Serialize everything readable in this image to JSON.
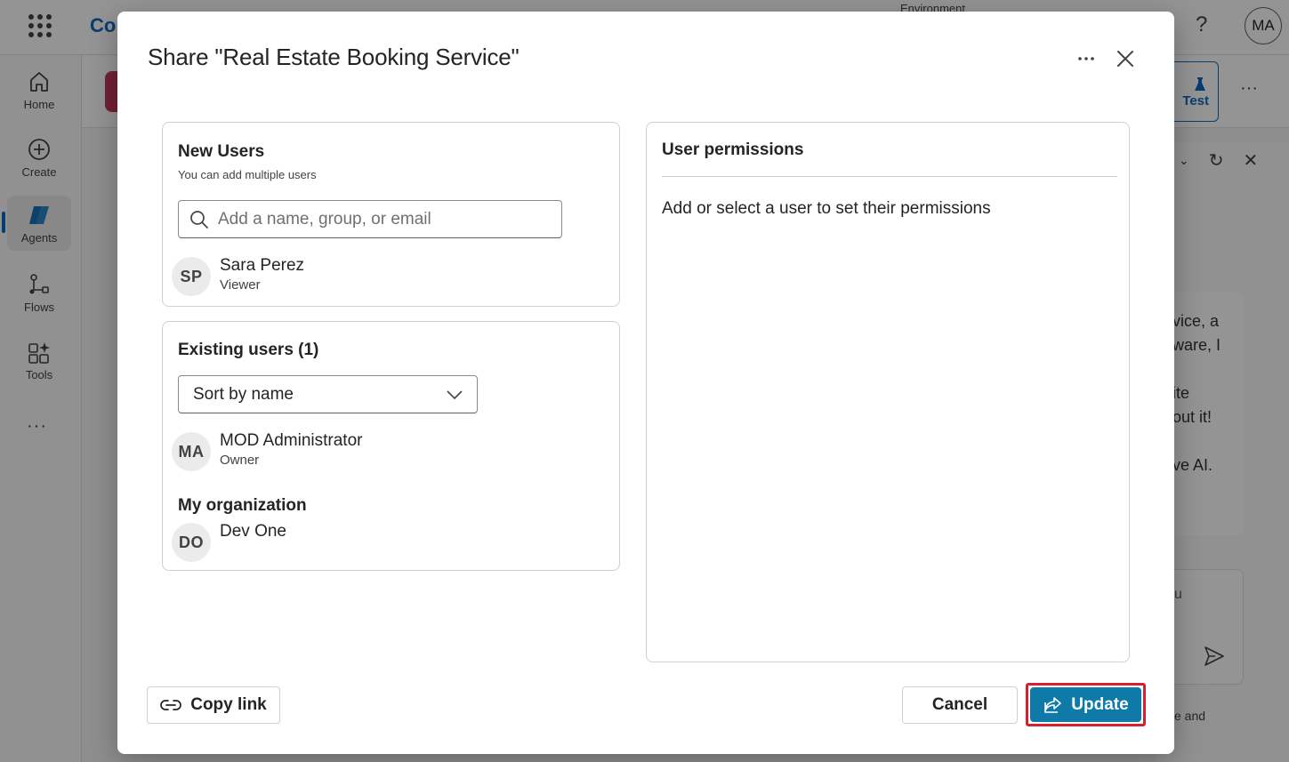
{
  "app": {
    "name_fragment": "Co",
    "environment_label": "Environment",
    "help_glyph": "?",
    "user_initials": "MA"
  },
  "rail": {
    "items": [
      {
        "label": "Home",
        "icon": "home-icon"
      },
      {
        "label": "Create",
        "icon": "add-circle-icon"
      },
      {
        "label": "Agents",
        "icon": "agents-icon"
      },
      {
        "label": "Flows",
        "icon": "flows-icon"
      },
      {
        "label": "Tools",
        "icon": "tools-icon"
      }
    ],
    "more": "···"
  },
  "background": {
    "test_label": "Test",
    "card_text": "vice, a\nware, I\n\nite\nout it!\n\nve AI.",
    "input_text": "u",
    "footer_text": "e and"
  },
  "dialog": {
    "title": "Share \"Real Estate Booking Service\"",
    "more_glyph": "···",
    "new_users": {
      "title": "New Users",
      "subtitle": "You can add multiple users",
      "search_placeholder": "Add a name, group, or email",
      "users": [
        {
          "initials": "SP",
          "name": "Sara Perez",
          "role": "Viewer"
        }
      ]
    },
    "existing_users": {
      "title": "Existing users (1)",
      "sort_value": "Sort by name",
      "users": [
        {
          "initials": "MA",
          "name": "MOD Administrator",
          "role": "Owner"
        }
      ],
      "org_title": "My organization",
      "org_members": [
        {
          "initials": "DO",
          "name": "Dev One"
        }
      ]
    },
    "permissions": {
      "title": "User permissions",
      "empty_message": "Add or select a user to set their permissions"
    },
    "footer": {
      "copy_link": "Copy link",
      "cancel": "Cancel",
      "update": "Update"
    }
  },
  "colors": {
    "primary": "#0f7aa8",
    "highlight_outline": "#d81f2f",
    "overlay": "rgba(0,0,0,0.42)"
  }
}
